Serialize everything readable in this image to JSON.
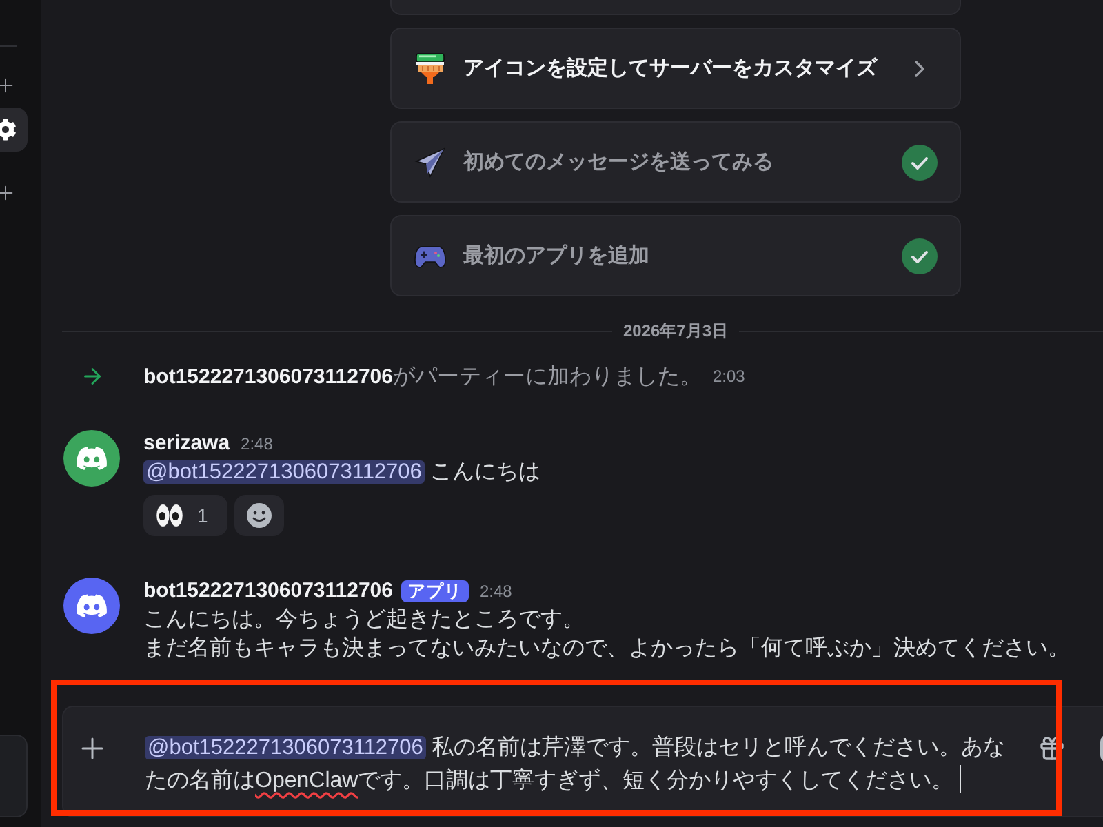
{
  "sidebar": {
    "items": [
      {
        "kind": "add",
        "selected": false
      },
      {
        "kind": "settings",
        "selected": true
      },
      {
        "kind": "add",
        "selected": false
      }
    ]
  },
  "checklist": [
    {
      "kind": "customize",
      "label": "アイコンを設定してサーバーをカスタマイズ",
      "done": false
    },
    {
      "kind": "message",
      "label": "初めてのメッセージを送ってみる",
      "done": true
    },
    {
      "kind": "app",
      "label": "最初のアプリを追加",
      "done": true
    }
  ],
  "date_divider": "2026年7月3日",
  "messages": [
    {
      "kind": "join",
      "user": "bot1522271306073112706",
      "text": "がパーティーに加わりました。",
      "time": "2:03"
    },
    {
      "kind": "message",
      "user": "serizawa",
      "color": "#3ba55c",
      "time": "2:48",
      "mention": "@bot1522271306073112706",
      "lines": [
        "こんにちは"
      ],
      "reactions": [
        {
          "kind": "emoji",
          "count": "1",
          "selected": false
        },
        {
          "kind": "add"
        }
      ]
    },
    {
      "kind": "message",
      "user": "bot1522271306073112706",
      "badge": "アプリ",
      "color": "#5865f2",
      "time": "2:48",
      "lines": [
        "こんにちは。今ちょうど起きたところです。",
        "まだ名前もキャラも決まってないみたいなので、よかったら「何て呼ぶか」決めてください。"
      ]
    }
  ],
  "composer": {
    "highlighted": true,
    "focused": true,
    "mention": "@bot1522271306073112706",
    "segments": [
      {
        "text": "私の名前は芹澤です。普段はセリと呼んでください。あなたの名前は",
        "misspelled": false
      },
      {
        "text": "OpenClaw",
        "misspelled": true
      },
      {
        "text": "です。口調は丁寧すぎず、短く分かりやすくしてください。",
        "misspelled": false
      }
    ]
  }
}
